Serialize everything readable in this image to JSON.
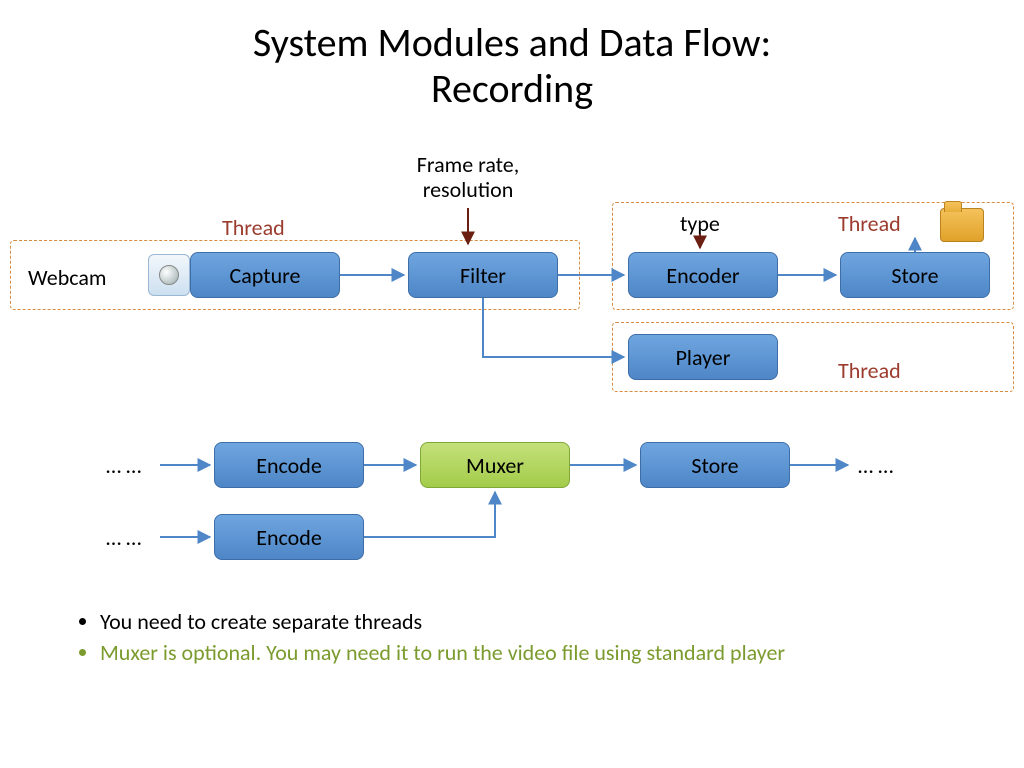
{
  "title_line1": "System Modules and Data Flow:",
  "title_line2": "Recording",
  "labels": {
    "webcam": "Webcam",
    "thread": "Thread",
    "framerate": "Frame rate,\nresolution",
    "type": "type",
    "ellipsis": "… …"
  },
  "boxes": {
    "capture": "Capture",
    "filter": "Filter",
    "encoder": "Encoder",
    "store": "Store",
    "player": "Player",
    "encode": "Encode",
    "muxer": "Muxer"
  },
  "bullets": {
    "b1": "You need to create separate threads",
    "b2": "Muxer is optional. You may need it to run the video file using standard player"
  }
}
